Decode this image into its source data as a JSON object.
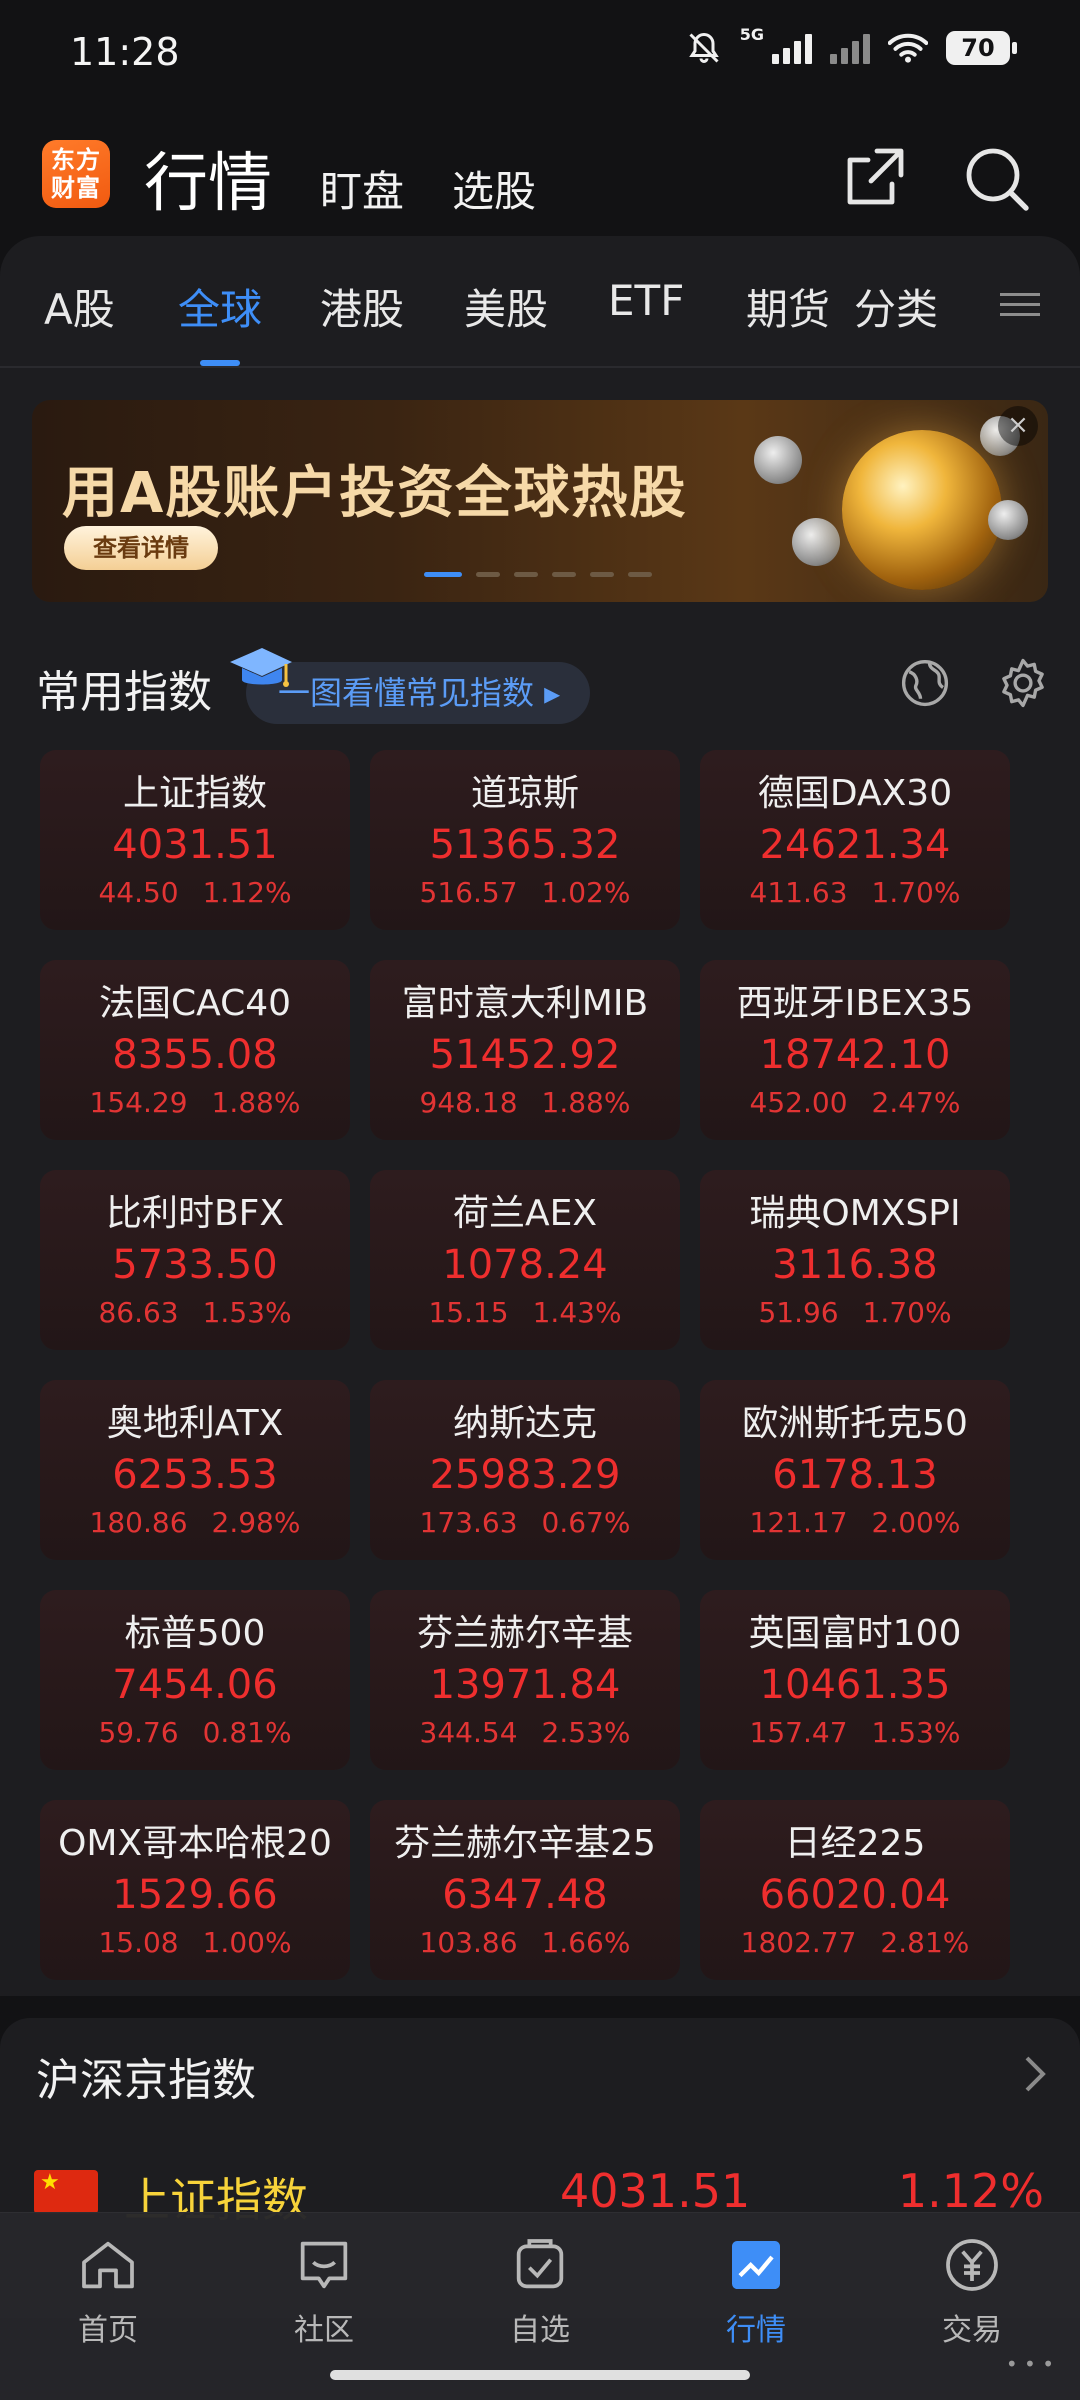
{
  "status": {
    "time": "11:28",
    "network": "5G",
    "battery": "70"
  },
  "header": {
    "logo_top": "东方",
    "logo_bottom": "财富",
    "title": "行情",
    "sub1": "盯盘",
    "sub2": "选股"
  },
  "tabs": [
    {
      "label": "A股"
    },
    {
      "label": "全球"
    },
    {
      "label": "港股"
    },
    {
      "label": "美股"
    },
    {
      "label": "ETF"
    },
    {
      "label": "期货"
    },
    {
      "label": "分类"
    }
  ],
  "banner": {
    "title": "用A股账户投资全球热股",
    "button": "查看详情",
    "close": "×"
  },
  "section": {
    "title": "常用指数",
    "guide": "一图看懂常见指数 ▸"
  },
  "indices": [
    {
      "name": "上证指数",
      "price": "4031.51",
      "change": "44.50",
      "pct": "1.12%"
    },
    {
      "name": "道琼斯",
      "price": "51365.32",
      "change": "516.57",
      "pct": "1.02%"
    },
    {
      "name": "德国DAX30",
      "price": "24621.34",
      "change": "411.63",
      "pct": "1.70%"
    },
    {
      "name": "法国CAC40",
      "price": "8355.08",
      "change": "154.29",
      "pct": "1.88%"
    },
    {
      "name": "富时意大利MIB",
      "price": "51452.92",
      "change": "948.18",
      "pct": "1.88%"
    },
    {
      "name": "西班牙IBEX35",
      "price": "18742.10",
      "change": "452.00",
      "pct": "2.47%"
    },
    {
      "name": "比利时BFX",
      "price": "5733.50",
      "change": "86.63",
      "pct": "1.53%"
    },
    {
      "name": "荷兰AEX",
      "price": "1078.24",
      "change": "15.15",
      "pct": "1.43%"
    },
    {
      "name": "瑞典OMXSPI",
      "price": "3116.38",
      "change": "51.96",
      "pct": "1.70%"
    },
    {
      "name": "奥地利ATX",
      "price": "6253.53",
      "change": "180.86",
      "pct": "2.98%"
    },
    {
      "name": "纳斯达克",
      "price": "25983.29",
      "change": "173.63",
      "pct": "0.67%"
    },
    {
      "name": "欧洲斯托克50",
      "price": "6178.13",
      "change": "121.17",
      "pct": "2.00%"
    },
    {
      "name": "标普500",
      "price": "7454.06",
      "change": "59.76",
      "pct": "0.81%"
    },
    {
      "name": "芬兰赫尔辛基",
      "price": "13971.84",
      "change": "344.54",
      "pct": "2.53%"
    },
    {
      "name": "英国富时100",
      "price": "10461.35",
      "change": "157.47",
      "pct": "1.53%"
    },
    {
      "name": "OMX哥本哈根20",
      "price": "1529.66",
      "change": "15.08",
      "pct": "1.00%"
    },
    {
      "name": "芬兰赫尔辛基25",
      "price": "6347.48",
      "change": "103.86",
      "pct": "1.66%"
    },
    {
      "name": "日经225",
      "price": "66020.04",
      "change": "1802.77",
      "pct": "2.81%"
    }
  ],
  "card2": {
    "title": "沪深京指数",
    "row": {
      "name": "上证指数",
      "price": "4031.51",
      "pct": "1.12%"
    }
  },
  "nav": [
    {
      "label": "首页",
      "icon": "home-icon"
    },
    {
      "label": "社区",
      "icon": "community-icon"
    },
    {
      "label": "自选",
      "icon": "watchlist-icon"
    },
    {
      "label": "行情",
      "icon": "market-icon"
    },
    {
      "label": "交易",
      "icon": "trade-icon"
    }
  ],
  "colors": {
    "accent": "#3e8ef7",
    "up": "#ef2e2e",
    "highlight": "#f7d33a"
  }
}
